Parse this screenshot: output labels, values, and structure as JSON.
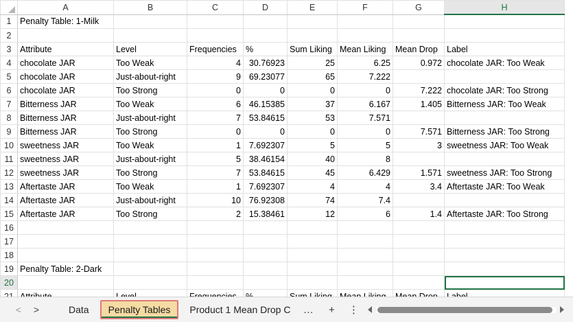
{
  "columns": [
    "A",
    "B",
    "C",
    "D",
    "E",
    "F",
    "G",
    "H"
  ],
  "selected_column": "H",
  "selected_row": 20,
  "rows": [
    {
      "n": "1",
      "cells": [
        "Penalty Table: 1-Milk",
        "",
        "",
        "",
        "",
        "",
        "",
        ""
      ]
    },
    {
      "n": "2",
      "cells": [
        "",
        "",
        "",
        "",
        "",
        "",
        "",
        ""
      ]
    },
    {
      "n": "3",
      "cells": [
        "Attribute",
        "Level",
        "Frequencies",
        "%",
        "Sum Liking",
        "Mean Liking",
        "Mean Drop",
        "Label"
      ]
    },
    {
      "n": "4",
      "cells": [
        "chocolate JAR",
        "Too Weak",
        "4",
        "30.76923",
        "25",
        "6.25",
        "0.972",
        "chocolate JAR: Too Weak"
      ]
    },
    {
      "n": "5",
      "cells": [
        "chocolate JAR",
        "Just-about-right",
        "9",
        "69.23077",
        "65",
        "7.222",
        "",
        ""
      ]
    },
    {
      "n": "6",
      "cells": [
        "chocolate JAR",
        "Too Strong",
        "0",
        "0",
        "0",
        "0",
        "7.222",
        "chocolate JAR: Too Strong"
      ]
    },
    {
      "n": "7",
      "cells": [
        "Bitterness JAR",
        "Too Weak",
        "6",
        "46.15385",
        "37",
        "6.167",
        "1.405",
        "Bitterness JAR: Too Weak"
      ]
    },
    {
      "n": "8",
      "cells": [
        "Bitterness JAR",
        "Just-about-right",
        "7",
        "53.84615",
        "53",
        "7.571",
        "",
        ""
      ]
    },
    {
      "n": "9",
      "cells": [
        "Bitterness JAR",
        "Too Strong",
        "0",
        "0",
        "0",
        "0",
        "7.571",
        "Bitterness JAR: Too Strong"
      ]
    },
    {
      "n": "10",
      "cells": [
        "sweetness JAR",
        "Too Weak",
        "1",
        "7.692307",
        "5",
        "5",
        "3",
        "sweetness JAR: Too Weak"
      ]
    },
    {
      "n": "11",
      "cells": [
        "sweetness JAR",
        "Just-about-right",
        "5",
        "38.46154",
        "40",
        "8",
        "",
        ""
      ]
    },
    {
      "n": "12",
      "cells": [
        "sweetness JAR",
        "Too Strong",
        "7",
        "53.84615",
        "45",
        "6.429",
        "1.571",
        "sweetness JAR: Too Strong"
      ]
    },
    {
      "n": "13",
      "cells": [
        "Aftertaste JAR",
        "Too Weak",
        "1",
        "7.692307",
        "4",
        "4",
        "3.4",
        "Aftertaste JAR: Too Weak"
      ]
    },
    {
      "n": "14",
      "cells": [
        "Aftertaste JAR",
        "Just-about-right",
        "10",
        "76.92308",
        "74",
        "7.4",
        "",
        ""
      ]
    },
    {
      "n": "15",
      "cells": [
        "Aftertaste JAR",
        "Too Strong",
        "2",
        "15.38461",
        "12",
        "6",
        "1.4",
        "Aftertaste JAR: Too Strong"
      ]
    },
    {
      "n": "16",
      "cells": [
        "",
        "",
        "",
        "",
        "",
        "",
        "",
        ""
      ]
    },
    {
      "n": "17",
      "cells": [
        "",
        "",
        "",
        "",
        "",
        "",
        "",
        ""
      ]
    },
    {
      "n": "18",
      "cells": [
        "",
        "",
        "",
        "",
        "",
        "",
        "",
        ""
      ]
    },
    {
      "n": "19",
      "cells": [
        "Penalty Table: 2-Dark",
        "",
        "",
        "",
        "",
        "",
        "",
        ""
      ]
    },
    {
      "n": "20",
      "cells": [
        "",
        "",
        "",
        "",
        "",
        "",
        "",
        ""
      ]
    },
    {
      "n": "21",
      "cells": [
        "Attribute",
        "Level",
        "Frequencies",
        "%",
        "Sum Liking",
        "Mean Liking",
        "Mean Drop",
        "Label"
      ]
    }
  ],
  "tabs": {
    "items": [
      "Data",
      "Penalty Tables",
      "Product 1 Mean Drop C"
    ],
    "active_index": 1,
    "more_label": "…",
    "add_label": "+",
    "options_label": "⋮",
    "prev_label": "<",
    "next_label": ">"
  },
  "colors": {
    "accent": "#217346",
    "active_tab_fill": "#f5dba3",
    "active_tab_border": "#e07a7a"
  }
}
